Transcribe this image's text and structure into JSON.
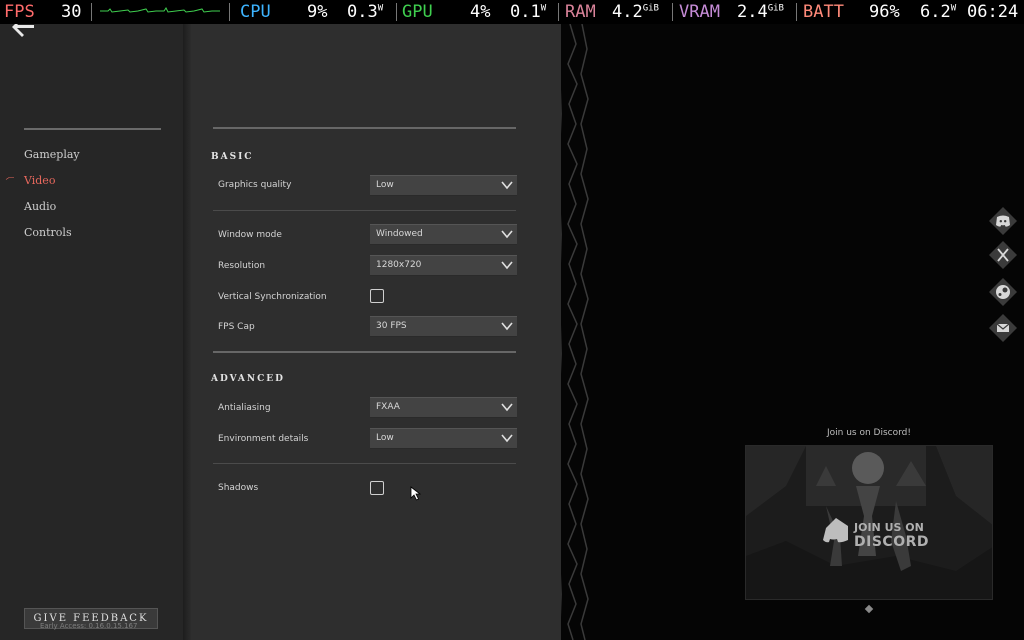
{
  "overlay": {
    "fps": {
      "label": "FPS",
      "value": "30"
    },
    "cpu": {
      "label": "CPU",
      "usage": "9%",
      "power": "0.3",
      "power_unit": "W"
    },
    "gpu": {
      "label": "GPU",
      "usage": "4%",
      "power": "0.1",
      "power_unit": "W"
    },
    "ram": {
      "label": "RAM",
      "value": "4.2",
      "unit": "GiB"
    },
    "vram": {
      "label": "VRAM",
      "value": "2.4",
      "unit": "GiB"
    },
    "batt": {
      "label": "BATT",
      "percent": "96%",
      "power": "6.2",
      "power_unit": "W"
    },
    "clock": "06:24"
  },
  "nav": {
    "items": [
      {
        "label": "Gameplay",
        "active": false
      },
      {
        "label": "Video",
        "active": true
      },
      {
        "label": "Audio",
        "active": false
      },
      {
        "label": "Controls",
        "active": false
      }
    ],
    "feedback_label": "GIVE FEEDBACK",
    "version": "Early Access: 0.16.0.15.167"
  },
  "settings": {
    "basic_title": "BASIC",
    "advanced_title": "ADVANCED",
    "graphics_quality": {
      "label": "Graphics quality",
      "value": "Low"
    },
    "window_mode": {
      "label": "Window mode",
      "value": "Windowed"
    },
    "resolution": {
      "label": "Resolution",
      "value": "1280x720"
    },
    "vsync": {
      "label": "Vertical Synchronization",
      "checked": false
    },
    "fps_cap": {
      "label": "FPS Cap",
      "value": "30 FPS"
    },
    "antialiasing": {
      "label": "Antialiasing",
      "value": "FXAA"
    },
    "environment_details": {
      "label": "Environment details",
      "value": "Low"
    },
    "shadows": {
      "label": "Shadows",
      "checked": false
    }
  },
  "social": {
    "icons": [
      "discord-icon",
      "x-icon",
      "steam-icon",
      "mail-icon"
    ],
    "discord_caption": "Join us on Discord!",
    "card_line1": "JOIN US ON",
    "card_line2": "DISCORD"
  },
  "colors": {
    "accent": "#e8685d",
    "panel_dark": "#262626",
    "panel": "#2e2e2e"
  }
}
